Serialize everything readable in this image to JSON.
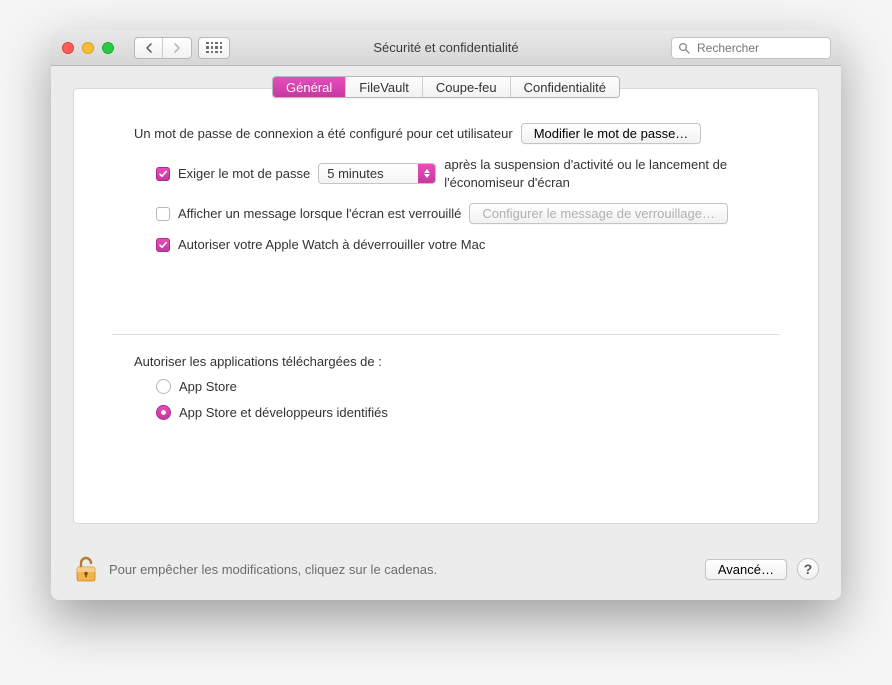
{
  "window": {
    "title": "Sécurité et confidentialité"
  },
  "search": {
    "placeholder": "Rechercher"
  },
  "tabs": {
    "general": "Général",
    "filevault": "FileVault",
    "firewall": "Coupe-feu",
    "privacy": "Confidentialité"
  },
  "general": {
    "password_configured_text": "Un mot de passe de connexion a été configuré pour cet utilisateur",
    "change_password_btn": "Modifier le mot de passe…",
    "require_password_label": "Exiger le mot de passe",
    "require_password_checked": true,
    "delay_selected": "5 minutes",
    "after_text": "après la suspension d'activité ou le lancement de l'économiseur d'écran",
    "show_message_label": "Afficher un message lorsque l'écran est verrouillé",
    "show_message_checked": false,
    "set_lock_message_btn": "Configurer le message de verrouillage…",
    "apple_watch_label": "Autoriser votre Apple Watch à déverrouiller votre Mac",
    "apple_watch_checked": true
  },
  "downloads": {
    "header": "Autoriser les applications téléchargées de :",
    "opt_appstore": "App Store",
    "opt_identified": "App Store et développeurs identifiés",
    "selected": "identified"
  },
  "footer": {
    "lock_text": "Pour empêcher les modifications, cliquez sur le cadenas.",
    "advanced_btn": "Avancé…",
    "help": "?"
  }
}
